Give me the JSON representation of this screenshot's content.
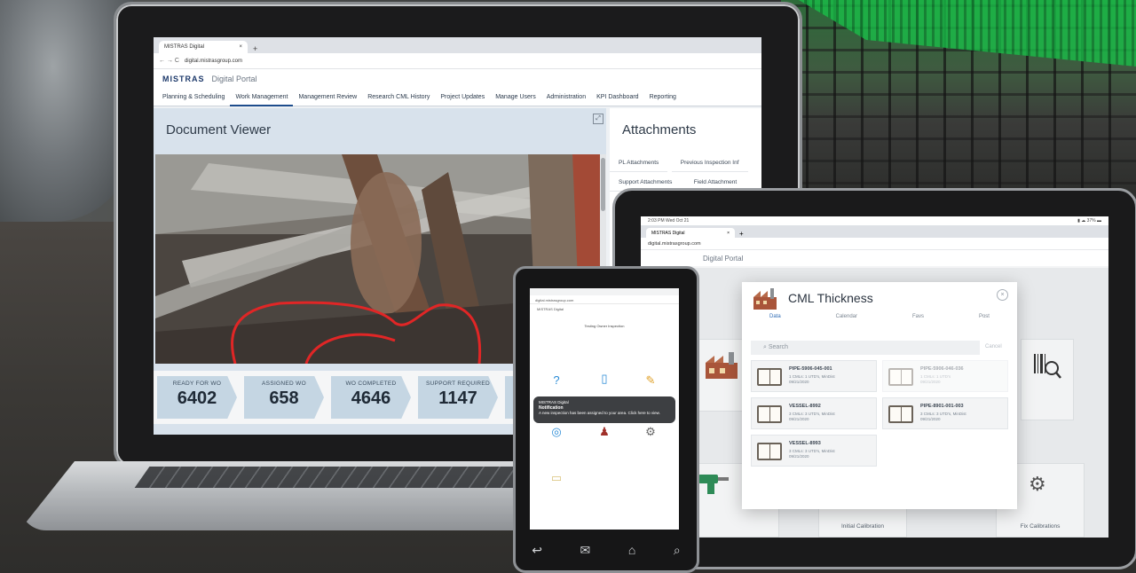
{
  "laptop": {
    "tab_title": "MISTRAS Digital",
    "tab_close": "×",
    "tab_new": "+",
    "nav_arrows": "← → C",
    "url": "digital.mistrasgroup.com",
    "brand_logo": "MISTRAS",
    "brand_portal": "Digital Portal",
    "nav": [
      "Planning & Scheduling",
      "Work Management",
      "Management Review",
      "Research CML History",
      "Project Updates",
      "Manage Users",
      "Administration",
      "KPI Dashboard",
      "Reporting"
    ],
    "active_nav_index": 1,
    "document_viewer_title": "Document Viewer",
    "attachments_title": "Attachments",
    "attachment_tabs": [
      "PL Attachments",
      "Previous Inspection Inf",
      "Support Attachments",
      "Field Attachment"
    ],
    "stats": [
      {
        "label": "READY FOR WO",
        "value": "6402"
      },
      {
        "label": "ASSIGNED WO",
        "value": "658"
      },
      {
        "label": "WO COMPLETED",
        "value": "4646"
      },
      {
        "label": "SUPPORT REQUIRED",
        "value": "1147"
      }
    ]
  },
  "tablet": {
    "status_time": "2:03 PM   Wed Oct 21",
    "status_right": "▮ ☁ 37% ▬",
    "tab_title": "MISTRAS Digital",
    "tab_new": "+",
    "url": "digital.mistrasgroup.com",
    "brand_portal": "Digital Portal",
    "card_labels": [
      "Initial Calibration",
      "Fix Calibrations"
    ],
    "cml": {
      "title": "CML Thickness",
      "close": "×",
      "tabs": [
        "Data",
        "Calendar",
        "Favs",
        "Post"
      ],
      "search_placeholder": "Search",
      "cancel": "Cancel",
      "items": [
        {
          "title": "PIPE-5906-045-001",
          "sub1": "1 CMLs: 1 UTD's, MinDist",
          "sub2": "09/21/2020",
          "dim": false
        },
        {
          "title": "PIPE-5906-046-036",
          "sub1": "1 CMLs: 1 UTD's",
          "sub2": "09/21/2020",
          "dim": true
        },
        {
          "title": "VESSEL-8992",
          "sub1": "3 CMLs: 3 UTD's, MinDist",
          "sub2": "09/21/2020",
          "dim": false
        },
        {
          "title": "PIPE-8901-001-003",
          "sub1": "3 CMLs: 3 UTD's, MinDist",
          "sub2": "09/21/2020",
          "dim": false
        },
        {
          "title": "VESSEL-8993",
          "sub1": "3 CMLs: 3 UTD's, MinDist",
          "sub2": "09/21/2020",
          "dim": false
        }
      ]
    }
  },
  "phone": {
    "url": "digital.mistrasgroup.com",
    "brand": "MISTRAS Digital",
    "header": "Testing Owner Inspection",
    "toast": {
      "app": "MISTRAS Digital",
      "title": "Notification",
      "body": "A new inspection has been assigned to your area. Click here to view."
    },
    "nav_icons": [
      "back-icon",
      "message-icon",
      "home-icon",
      "search-icon"
    ]
  }
}
